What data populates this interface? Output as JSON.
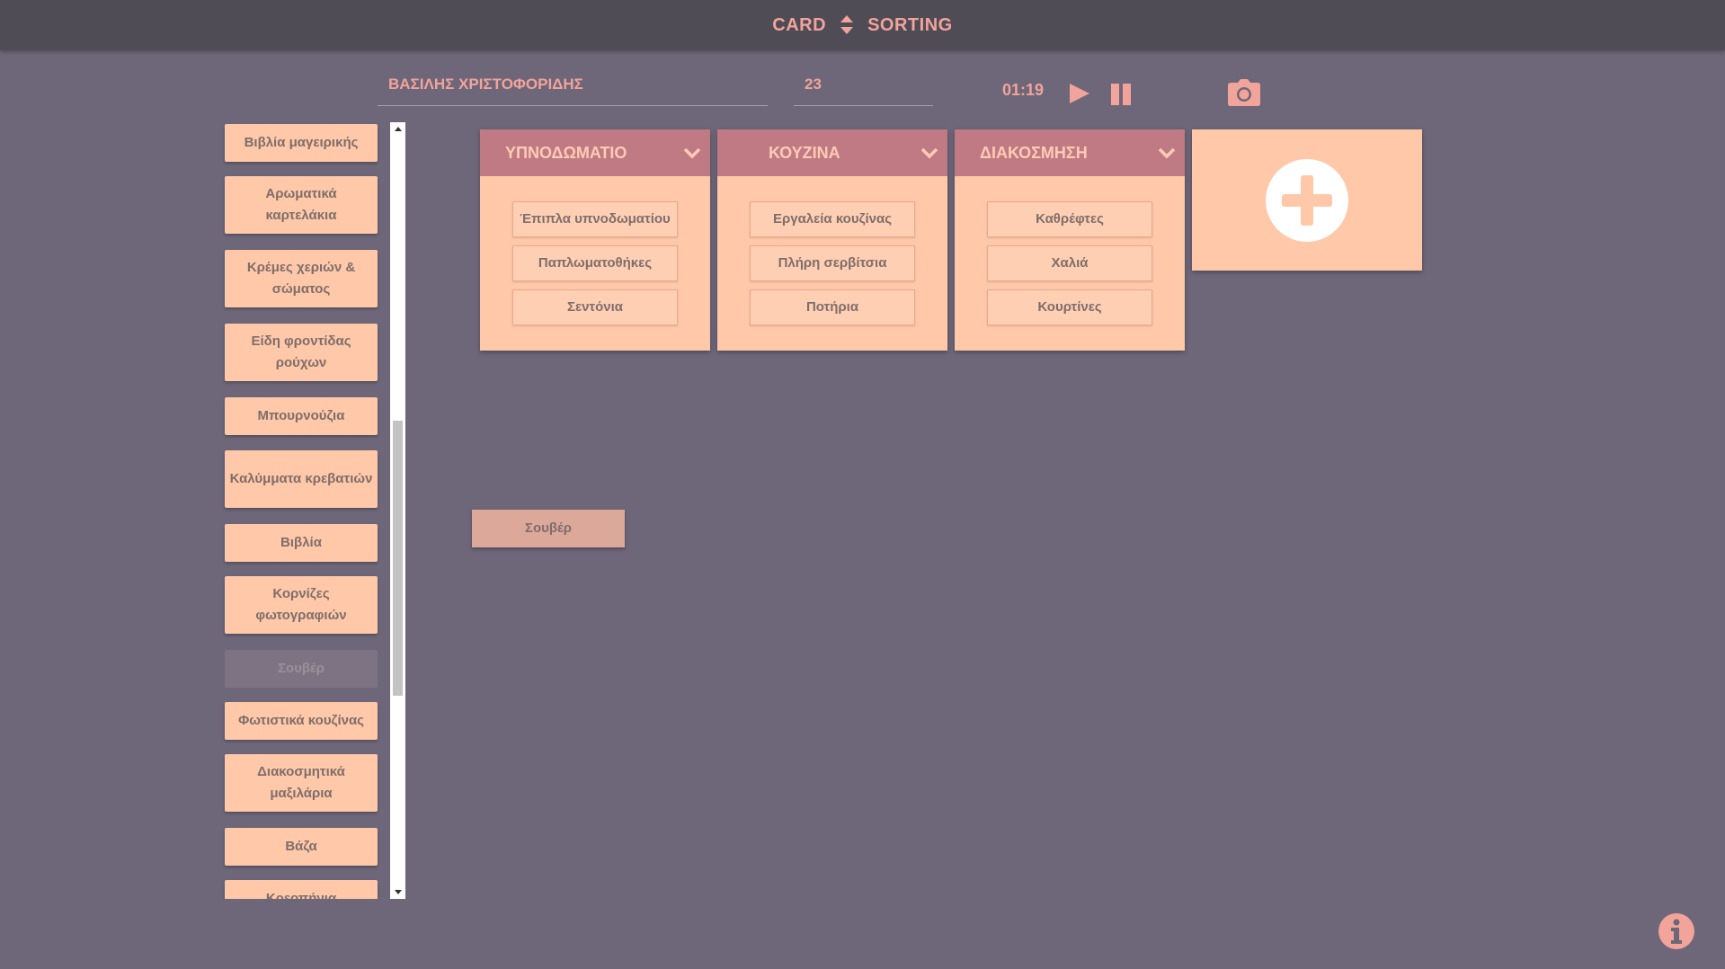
{
  "header": {
    "brand_left": "CARD",
    "brand_right": "SORTING",
    "swap_icon": "sort-arrows-icon"
  },
  "toolbar": {
    "name_value": "ΒΑΣΙΛΗΣ ΧΡΙΣΤΟΦΟΡΙΔΗΣ",
    "number_value": "23",
    "timer": "01:19"
  },
  "cards": [
    "Βιβλία μαγειρικής",
    "Αρωματικά καρτελάκια",
    "Κρέμες χεριών & σώματος",
    "Είδη φροντίδας ρούχων",
    "Μπουρνούζια",
    "Καλύμματα κρεβατιών",
    "Βιβλία",
    "Κορνίζες φωτογραφιών",
    "Σουβέρ",
    "Φωτιστικά κουζίνας",
    "Διακοσμητικά μαξιλάρια",
    "Βάζα",
    "Κρεοπήνια"
  ],
  "categories": [
    {
      "title": "ΥΠΝΟΔΩΜΑΤΙΟ",
      "items": [
        "Έπιπλα υπνοδωματίου",
        "Παπλωματοθήκες",
        "Σεντόνια"
      ]
    },
    {
      "title": "ΚΟΥΖΙΝΑ",
      "items": [
        "Εργαλεία κουζίνας",
        "Πλήρη σερβίτσια",
        "Ποτήρια"
      ]
    },
    {
      "title": "ΔΙΑΚΟΣΜΗΣΗ",
      "items": [
        "Καθρέφτες",
        "Χαλιά",
        "Κουρτίνες"
      ]
    }
  ],
  "dragging_card": "Σουβέρ",
  "colors": {
    "background": "#6d6779",
    "topbar": "#4f4c56",
    "accent": "#f2a39a",
    "card": "#ffc8a8",
    "category_header": "#c07a84"
  }
}
